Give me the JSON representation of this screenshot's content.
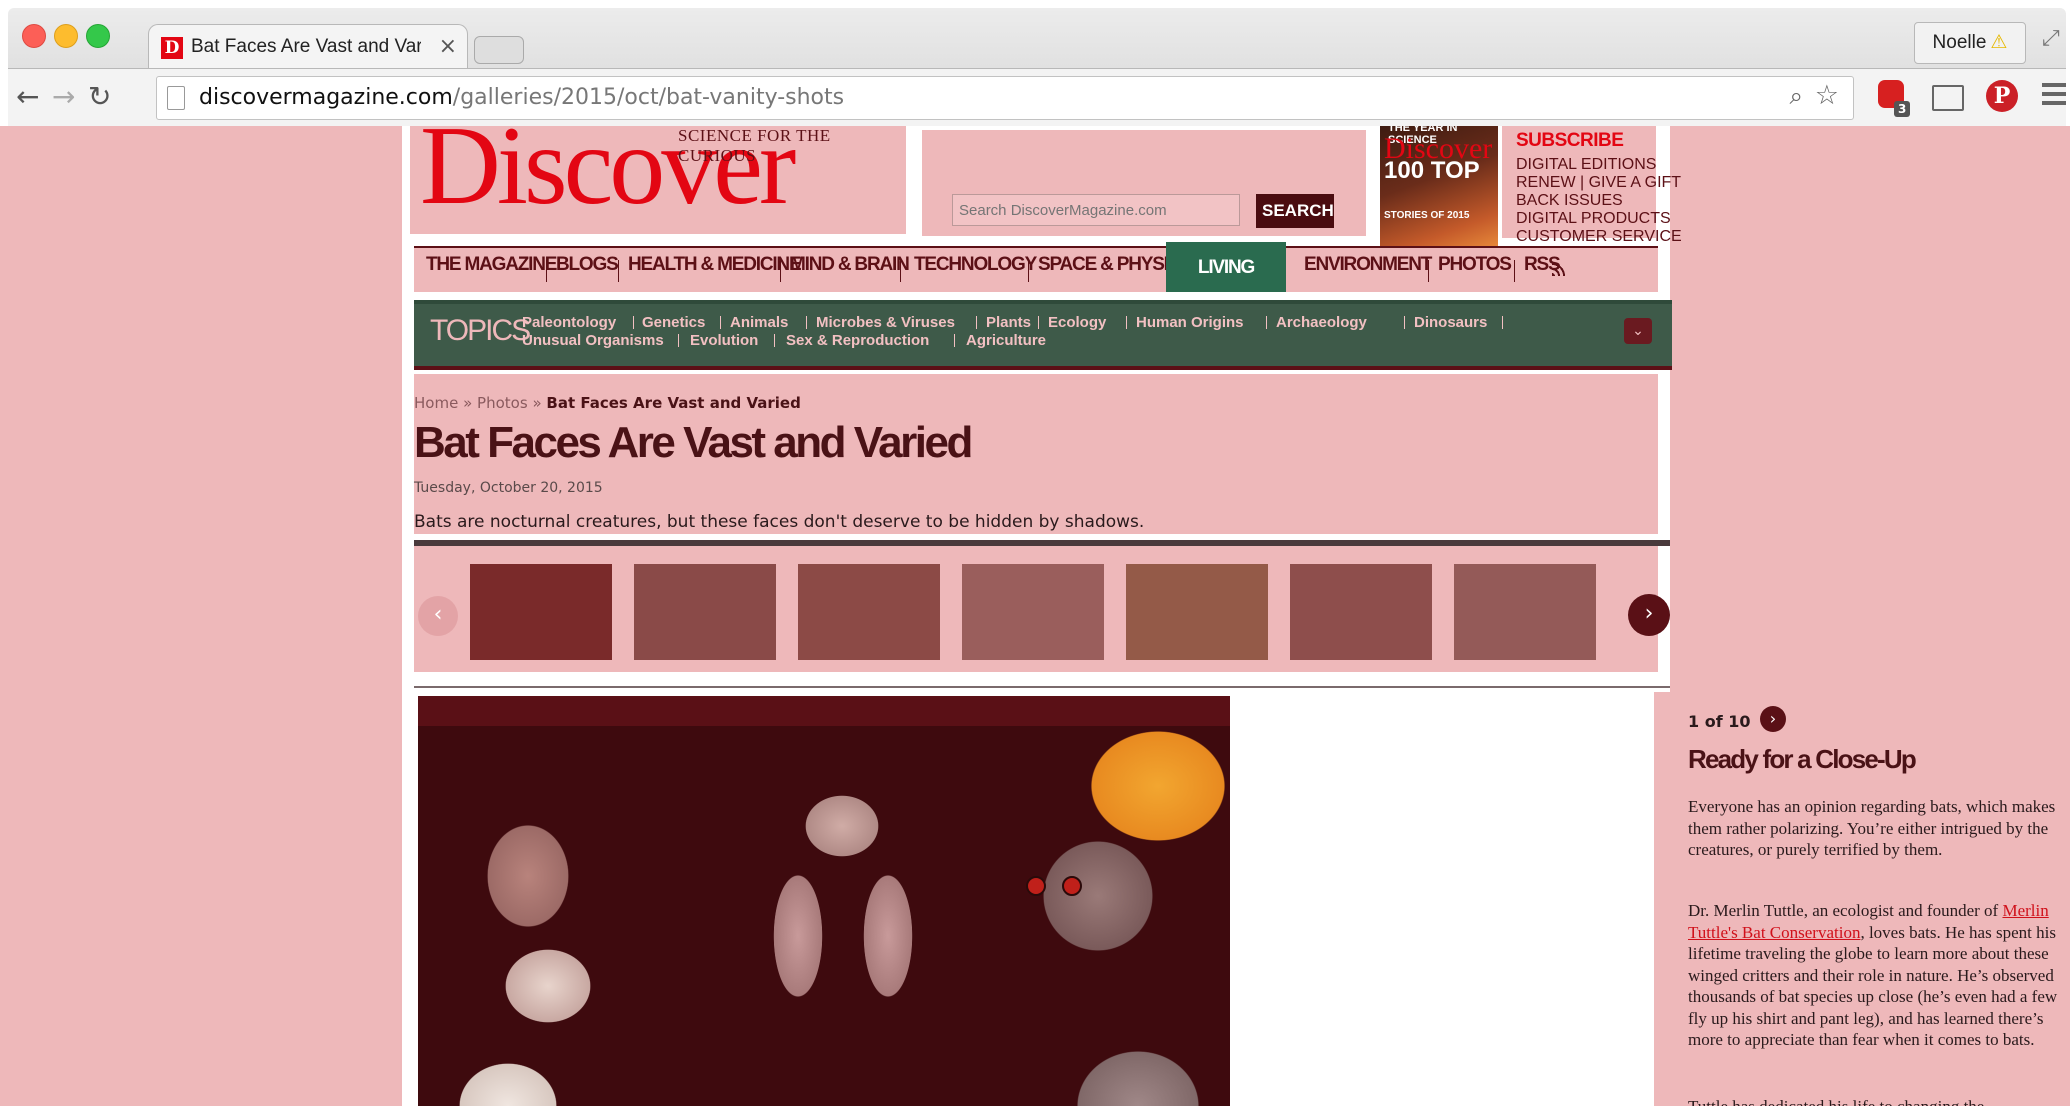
{
  "browser": {
    "tab_title": "Bat Faces Are Vast and Varied",
    "tab_close": "×",
    "favicon_letter": "D",
    "profile_name": "Noelle",
    "profile_warning_icon": "⚠",
    "url_domain": "discovermagazine.com",
    "url_path": "/galleries/2015/oct/bat-vanity-shots",
    "back": "←",
    "forward": "→",
    "reload": "↻",
    "adblock_badge": "3",
    "pinterest_letter": "P",
    "star": "☆",
    "zoom": "⌕",
    "fullscreen": "⤢"
  },
  "header": {
    "logo": "Discover",
    "tagline": "SCIENCE FOR THE CURIOUS",
    "search_placeholder": "Search DiscoverMagazine.com",
    "search_button": "SEARCH",
    "cover": {
      "year_line": "THE YEAR IN SCIENCE",
      "logo": "Discover",
      "headline": "100 TOP",
      "sub": "STORIES OF 2015"
    },
    "subscribe": "SUBSCRIBE",
    "sub_links": [
      "DIGITAL EDITIONS",
      "RENEW | GIVE A GIFT",
      "BACK ISSUES",
      "DIGITAL PRODUCTS",
      "CUSTOMER SERVICE"
    ]
  },
  "nav": {
    "items": [
      "THE MAGAZINE",
      "BLOGS",
      "HEALTH & MEDICINE",
      "MIND & BRAIN",
      "TECHNOLOGY",
      "SPACE & PHYSICS",
      "LIVING WORLD",
      "ENVIRONMENT",
      "PHOTOS",
      "RSS"
    ],
    "active": "LIVING WORLD"
  },
  "topics": {
    "label": "TOPICS",
    "row1": [
      "Paleontology",
      "Genetics",
      "Animals",
      "Microbes & Viruses",
      "Plants",
      "Ecology",
      "Human Origins",
      "Archaeology",
      "Dinosaurs"
    ],
    "row2": [
      "Unusual Organisms",
      "Evolution",
      "Sex & Reproduction",
      "Agriculture"
    ],
    "toggle": "⌄"
  },
  "article": {
    "breadcrumb_home": "Home",
    "breadcrumb_sep": "»",
    "breadcrumb_photos": "Photos",
    "breadcrumb_current": "Bat Faces Are Vast and Varied",
    "title": "Bat Faces Are Vast and Varied",
    "date": "Tuesday, October 20, 2015",
    "dek": "Bats are nocturnal creatures, but these faces don't deserve to be hidden by shadows."
  },
  "gallery": {
    "prev": "‹",
    "next": "›",
    "thumb_colors": [
      "#7a2a2a",
      "#8a4a48",
      "#8c4a46",
      "#9a5e5c",
      "#945a48",
      "#8e4e4c",
      "#945a58"
    ]
  },
  "slide": {
    "counter": "1 of 10",
    "next": "›",
    "title": "Ready for a Close-Up",
    "p1": "Everyone has an opinion regarding bats, which makes them rather polarizing. You’re either intrigued by the creatures, or purely terrified by them.",
    "p2_before": "Dr. Merlin Tuttle, an ecologist and founder of ",
    "p2_link": "Merlin Tuttle's Bat Conservation",
    "p2_after": ", loves bats. He has spent his lifetime traveling the globe to learn more about these winged critters and their role in nature. He’s observed thousands of bat species up close (he’s even had a few fly up his shirt and pant leg), and has learned there’s more to appreciate than fear when it comes to bats.",
    "p3": "Tuttle has dedicated his life to changing the"
  }
}
